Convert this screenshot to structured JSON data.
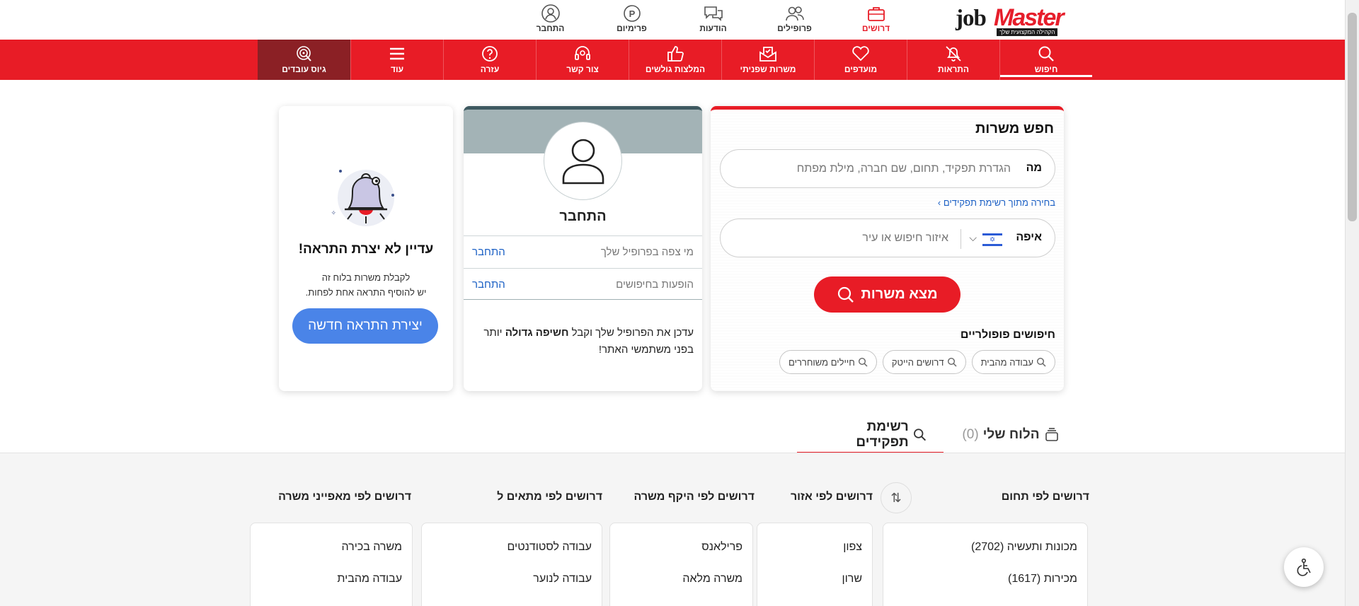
{
  "logo": {
    "job": "job",
    "master": "Master",
    "slogan": "הקהילה המקצועית שלך"
  },
  "topnav": [
    {
      "label": "דרושים",
      "icon": "briefcase-icon",
      "active": true
    },
    {
      "label": "פרופילים",
      "icon": "people-icon"
    },
    {
      "label": "הודעות",
      "icon": "chat-icon"
    },
    {
      "label": "פרימיום",
      "icon": "premium-icon"
    },
    {
      "label": "התחבר",
      "icon": "user-icon"
    }
  ],
  "rednav": [
    {
      "label": "חיפוש",
      "icon": "search-icon",
      "active": true
    },
    {
      "label": "התראות",
      "icon": "bell-off-icon"
    },
    {
      "label": "מועדפים",
      "icon": "heart-icon"
    },
    {
      "label": "משרות שפניתי",
      "icon": "applied-icon"
    },
    {
      "label": "המלצות גולשים",
      "icon": "thumbs-up-icon"
    },
    {
      "label": "צור קשר",
      "icon": "headset-icon"
    },
    {
      "label": "עזרה",
      "icon": "help-icon"
    },
    {
      "label": "עוד",
      "icon": "menu-icon"
    },
    {
      "label": "גיוס עובדים",
      "icon": "target-icon"
    }
  ],
  "search": {
    "title": "חפש משרות",
    "what_label": "מה",
    "what_placeholder": "הגדרת תפקיד, תחום, שם חברה, מילת מפתח",
    "role_link": "בחירה מתוך רשימת תפקידים ›",
    "where_label": "איפה",
    "where_placeholder": "איזור חיפוש או עיר",
    "find_button": "מצא משרות",
    "popular_title": "חיפושים פופולריים",
    "popular": [
      "עבודה מהבית",
      "דרושים הייטק",
      "חיילים משוחררים"
    ]
  },
  "profile": {
    "name": "התחבר",
    "rows": [
      {
        "text": "מי צפה בפרופיל שלך",
        "link": "התחבר"
      },
      {
        "text": "הופעות בחיפושים",
        "link": "התחבר"
      }
    ],
    "promo_pre": "עדכן את הפרופיל שלך וקבל ",
    "promo_bold": "חשיפה גדולה",
    "promo_post": " יותר בפני משתמשי האתר!"
  },
  "alert": {
    "title": "עדיין לא יצרת התראה!",
    "desc_line1": "לקבלת משרות בלוח זה",
    "desc_line2": "יש להוסיף התראה אחת לפחות.",
    "button": "יצירת התראה חדשה"
  },
  "tabs": {
    "board_label": "הלוח שלי",
    "board_count": "(0)",
    "roles_label": "רשימת תפקידים"
  },
  "columns": [
    {
      "title": "דרושים לפי תחום",
      "items": [
        "מכונות ותעשיה (2702)",
        "מכירות (1617)"
      ]
    },
    {
      "title": "דרושים לפי אזור",
      "items": [
        "צפון",
        "שרון"
      ]
    },
    {
      "title": "דרושים לפי היקף משרה",
      "items": [
        "פרילאנס",
        "משרה מלאה"
      ]
    },
    {
      "title": "דרושים לפי מתאים ל",
      "items": [
        "עבודה לסטודנטים",
        "עבודה לנוער"
      ]
    },
    {
      "title": "דרושים לפי מאפייני משרה",
      "items": [
        "משרה בכירה",
        "עבודה מהבית"
      ]
    }
  ],
  "colors": {
    "brand_red": "#e81c26",
    "dark_red": "#8b2025",
    "link_blue": "#1a5fc4",
    "button_blue": "#4a84e8"
  }
}
